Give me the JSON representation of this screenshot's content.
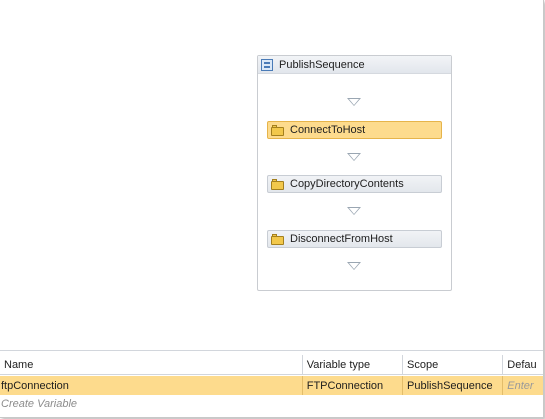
{
  "workflow": {
    "sequence_title": "PublishSequence",
    "activities": [
      {
        "label": "ConnectToHost",
        "selected": true
      },
      {
        "label": "CopyDirectoryContents",
        "selected": false
      },
      {
        "label": "DisconnectFromHost",
        "selected": false
      }
    ]
  },
  "variables": {
    "columns": [
      "Name",
      "Variable type",
      "Scope",
      "Defau"
    ],
    "rows": [
      {
        "name": "ftpConnection",
        "type": "FTPConnection",
        "scope": "PublishSequence",
        "default_placeholder": "Enter"
      }
    ],
    "create_label": "Create Variable"
  },
  "colors": {
    "selection": "#fddb8d",
    "activity_bg": "#e8ebef",
    "border": "#c9ccd1"
  }
}
